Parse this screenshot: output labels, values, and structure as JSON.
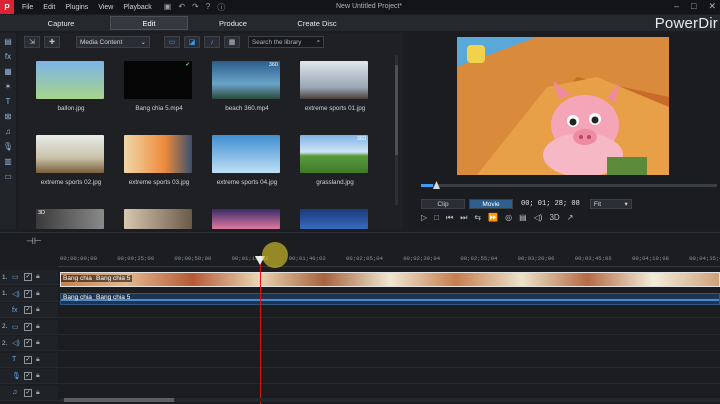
{
  "titlebar": {
    "logo": "P",
    "menu": [
      "File",
      "Edit",
      "Plugins",
      "View",
      "Playback"
    ],
    "quick_actions": [
      "save-icon",
      "undo-icon",
      "redo-icon",
      "help-icon",
      "info-icon"
    ],
    "doc_title": "New Untitled Project*",
    "window_controls": [
      "minimize-icon",
      "maximize-icon",
      "close-icon"
    ]
  },
  "modes": {
    "tabs": [
      "Capture",
      "Edit",
      "Produce",
      "Create Disc"
    ],
    "active": "Edit",
    "brand": "PowerDir"
  },
  "library": {
    "media_filter": "Media Content",
    "search_placeholder": "Search the library",
    "items": [
      {
        "name": "ballon.jpg",
        "badge": ""
      },
      {
        "name": "Bang chia 5.mp4",
        "badge": ""
      },
      {
        "name": "beach 360.mp4",
        "badge": "360"
      },
      {
        "name": "extreme sports 01.jpg",
        "badge": ""
      },
      {
        "name": "extreme sports 02.jpg",
        "badge": ""
      },
      {
        "name": "extreme sports 03.jpg",
        "badge": ""
      },
      {
        "name": "extreme sports 04.jpg",
        "badge": ""
      },
      {
        "name": "grassland.jpg",
        "badge": "360"
      },
      {
        "name": "",
        "badge": "3D"
      },
      {
        "name": "",
        "badge": ""
      },
      {
        "name": "",
        "badge": ""
      },
      {
        "name": "",
        "badge": ""
      }
    ]
  },
  "preview": {
    "segments": [
      "Clip",
      "Movie"
    ],
    "active_segment": "Movie",
    "timecode": "00; 01; 28; 08",
    "fit": "Fit",
    "progress_fraction": 0.04,
    "controls": [
      "play-icon",
      "stop-icon",
      "prev-frame-icon",
      "next-frame-icon",
      "snapshot-icon",
      "subtitle-icon",
      "volume-icon",
      "3D",
      "undock-icon"
    ]
  },
  "timeline": {
    "ruler_ticks": [
      "00;00;00;00",
      "00;00;25;00",
      "00;00;50;00",
      "00;01;15;02",
      "00;01;40;02",
      "00;02;05;04",
      "00;02;30;04",
      "00;02;55;04",
      "00;03;20;06",
      "00;03;45;06",
      "00;04;10;08",
      "00;04;35;08"
    ],
    "tracks": [
      {
        "num": "1.",
        "icon": "video-track-icon"
      },
      {
        "num": "1.",
        "icon": "audio-track-icon"
      },
      {
        "num": "",
        "icon": "fx-track-icon"
      },
      {
        "num": "2.",
        "icon": "video-track-icon"
      },
      {
        "num": "2.",
        "icon": "audio-track-icon"
      },
      {
        "num": "",
        "icon": "title-track-icon"
      },
      {
        "num": "",
        "icon": "voice-track-icon"
      },
      {
        "num": "",
        "icon": "music-track-icon"
      }
    ],
    "video_clips": [
      "Bang chia",
      "Bang chia 5"
    ],
    "audio_clips": [
      "Bang chia",
      "Bang chia 5"
    ]
  },
  "colors": {
    "accent": "#3b9cf2",
    "playhead": "#dd1111"
  }
}
